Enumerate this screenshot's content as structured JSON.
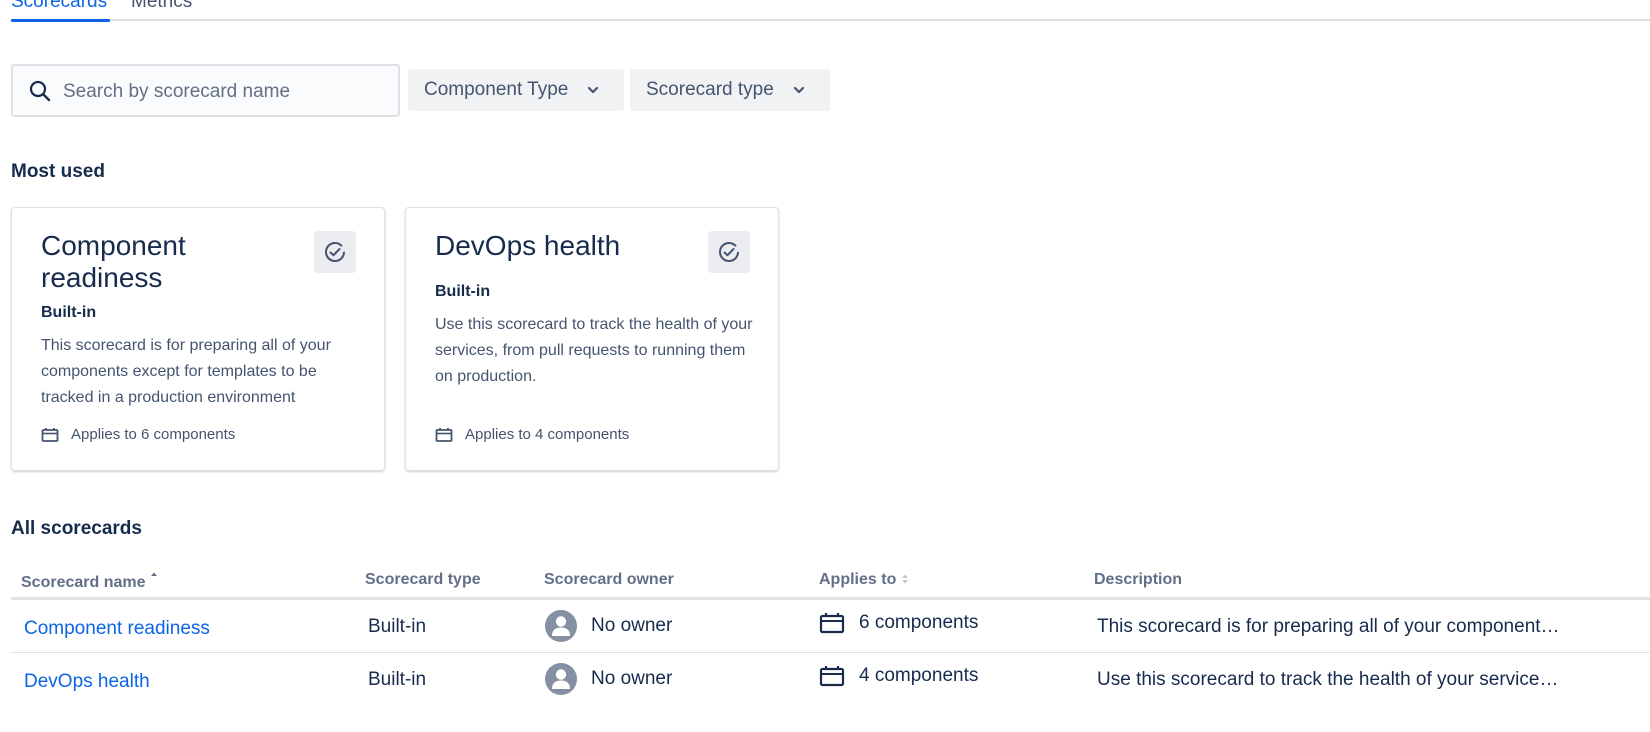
{
  "tabs": [
    {
      "label": "Scorecards",
      "active": true
    },
    {
      "label": "Metrics",
      "active": false
    }
  ],
  "search": {
    "placeholder": "Search by scorecard name",
    "value": ""
  },
  "filters": {
    "component_type": "Component Type",
    "scorecard_type": "Scorecard type"
  },
  "most_used": {
    "title": "Most used",
    "cards": [
      {
        "title": "Component readiness",
        "type": "Built-in",
        "description": "This scorecard is for preparing all of your components except for templates to be tracked in a production environment",
        "applies": "Applies to 6 components",
        "badge_icon": "check-circle-icon"
      },
      {
        "title": "DevOps health",
        "type": "Built-in",
        "description": "Use this scorecard to track the health of your services, from pull requests to running them on production.",
        "applies": "Applies to 4 components",
        "badge_icon": "check-circle-icon"
      }
    ]
  },
  "all_scorecards": {
    "title": "All scorecards",
    "columns": {
      "name": "Scorecard name",
      "type": "Scorecard type",
      "owner": "Scorecard owner",
      "applies": "Applies to",
      "description": "Description"
    },
    "sort": {
      "column": "name",
      "direction": "ascending"
    },
    "rows": [
      {
        "name": "Component readiness",
        "type": "Built-in",
        "owner": "No owner",
        "applies": "6 components",
        "description": "This scorecard is for preparing all of your component…"
      },
      {
        "name": "DevOps health",
        "type": "Built-in",
        "owner": "No owner",
        "applies": "4 components",
        "description": "Use this scorecard to track the health of your service…"
      }
    ]
  },
  "colors": {
    "accent": "#0c66e4",
    "text": "#172b4d",
    "subtle_text": "#44546f",
    "border": "#dfe1e6",
    "filter_bg": "#f1f2f4"
  }
}
